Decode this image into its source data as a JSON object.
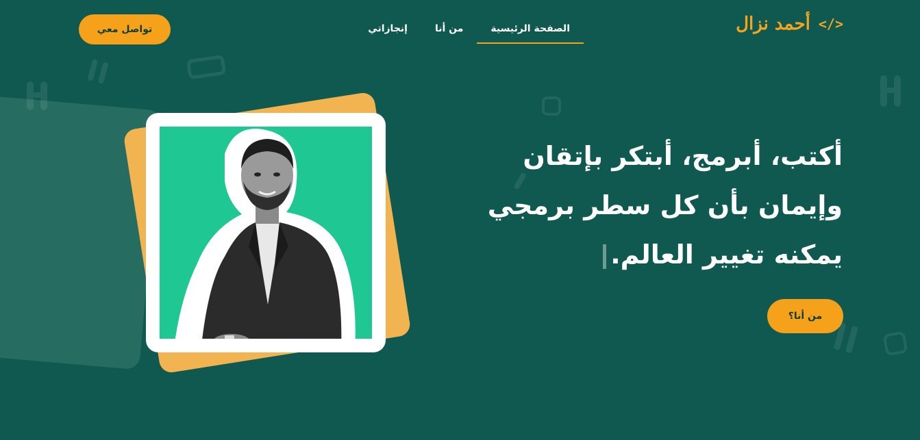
{
  "header": {
    "logo_text": "أحمد نزال",
    "logo_icon": "</>",
    "nav": [
      {
        "label": "الصفحة الرئيسية",
        "active": true
      },
      {
        "label": "من أنا",
        "active": false
      },
      {
        "label": "إنجازاتي",
        "active": false
      }
    ],
    "contact_label": "تواصل معي"
  },
  "hero": {
    "line1": "أكتب، أبرمج، أبتكر بإتقان",
    "line2": "وإيمان بأن كل سطر برمجي",
    "line3": "يمكنه تغيير العالم.",
    "about_button": "من أنا؟"
  },
  "colors": {
    "background": "#0f5950",
    "accent": "#f5a11a",
    "photo_green": "#1fc892"
  },
  "icons": {
    "logo": "code-brackets-icon",
    "photo": "portrait-photo"
  }
}
